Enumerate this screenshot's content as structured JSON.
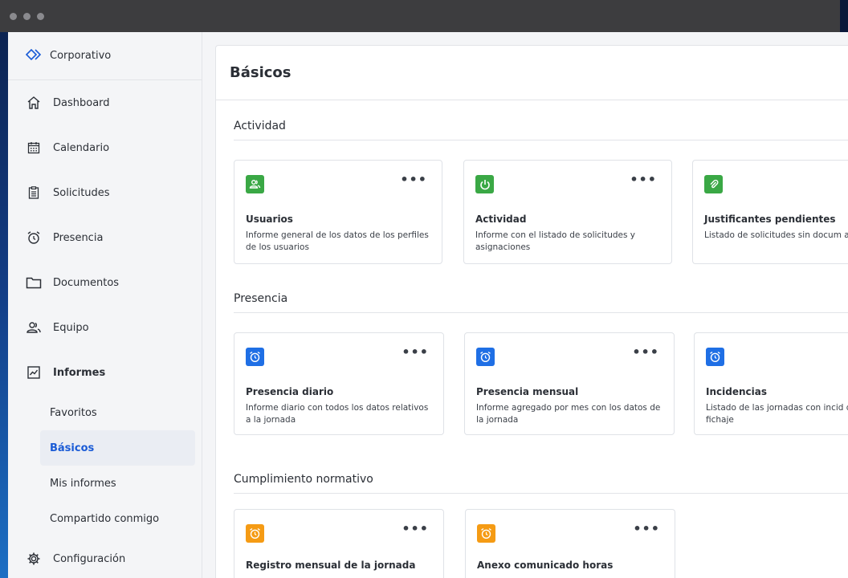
{
  "brand": {
    "name": "Corporativo"
  },
  "nav": [
    {
      "id": "dashboard",
      "label": "Dashboard",
      "icon": "home-icon"
    },
    {
      "id": "calendario",
      "label": "Calendario",
      "icon": "calendar-icon"
    },
    {
      "id": "solicitudes",
      "label": "Solicitudes",
      "icon": "clipboard-icon"
    },
    {
      "id": "presencia",
      "label": "Presencia",
      "icon": "alarm-clock-icon"
    },
    {
      "id": "documentos",
      "label": "Documentos",
      "icon": "folder-icon"
    },
    {
      "id": "equipo",
      "label": "Equipo",
      "icon": "team-icon"
    },
    {
      "id": "informes",
      "label": "Informes",
      "icon": "chart-icon"
    }
  ],
  "informes_sub": [
    {
      "label": "Favoritos",
      "active": false
    },
    {
      "label": "Básicos",
      "active": true
    },
    {
      "label": "Mis informes",
      "active": false
    },
    {
      "label": "Compartido conmigo",
      "active": false
    }
  ],
  "config": {
    "label": "Configuración",
    "icon": "gear-icon"
  },
  "main": {
    "title": "Básicos",
    "sections": [
      {
        "title": "Actividad",
        "cards": [
          {
            "title": "Usuarios",
            "desc": "Informe general de los datos de los perfiles de los usuarios",
            "color": "#3aa845",
            "icon": "users-icon"
          },
          {
            "title": "Actividad",
            "desc": "Informe con el listado de solicitudes y asignaciones",
            "color": "#3aa845",
            "icon": "power-icon"
          },
          {
            "title": "Justificantes pendientes",
            "desc": "Listado de solicitudes sin docum adjuntos",
            "color": "#3aa845",
            "icon": "paperclip-icon"
          }
        ]
      },
      {
        "title": "Presencia",
        "cards": [
          {
            "title": "Presencia diario",
            "desc": "Informe diario con todos los datos relativos a la jornada",
            "color": "#1f6fe5",
            "icon": "alarm-clock-icon"
          },
          {
            "title": "Presencia mensual",
            "desc": "Informe agregado por mes con los datos de la jornada",
            "color": "#1f6fe5",
            "icon": "alarm-clock-icon"
          },
          {
            "title": "Incidencias",
            "desc": "Listado de las jornadas con incid de fichaje",
            "color": "#1f6fe5",
            "icon": "alarm-clock-icon"
          }
        ]
      },
      {
        "title": "Cumplimiento normativo",
        "cards": [
          {
            "title": "Registro mensual de la jornada",
            "desc": "",
            "color": "#f59b14",
            "icon": "alarm-clock-icon"
          },
          {
            "title": "Anexo comunicado horas",
            "desc": "",
            "color": "#f59b14",
            "icon": "alarm-clock-icon"
          }
        ]
      }
    ],
    "more_label": "•••"
  }
}
